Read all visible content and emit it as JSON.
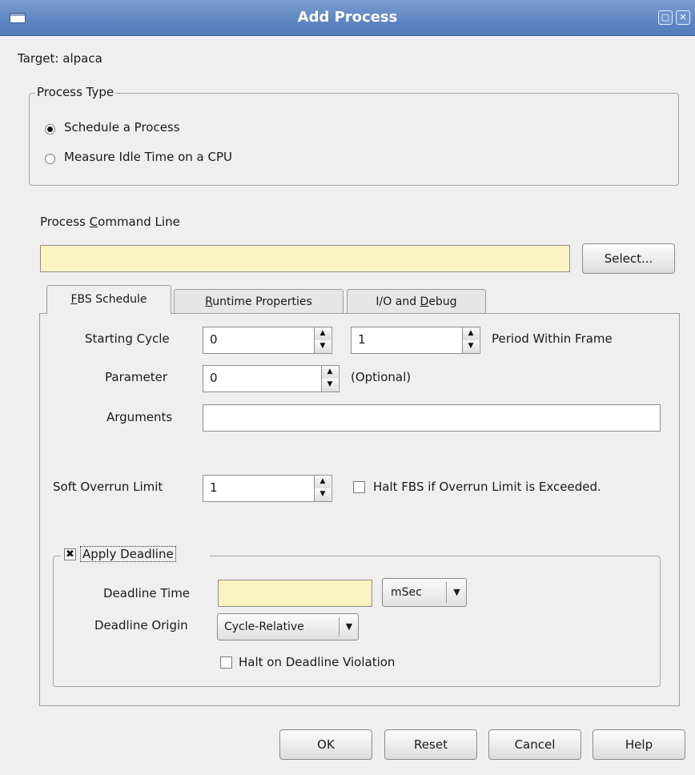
{
  "window": {
    "title": "Add Process",
    "icons": [
      "window-menu-icon",
      "maximize-icon",
      "close-icon"
    ]
  },
  "target": {
    "label": "Target:",
    "value": "alpaca"
  },
  "process_type": {
    "legend": "Process Type",
    "options": [
      {
        "label": "Schedule a Process",
        "selected": true
      },
      {
        "label": "Measure Idle Time on a CPU",
        "selected": false
      }
    ]
  },
  "command_line": {
    "label_pre": "Process ",
    "label_mnemonic": "C",
    "label_post": "ommand Line",
    "value": "",
    "select_label": "Select..."
  },
  "tabs": [
    {
      "mnemonic": "F",
      "rest": "BS Schedule",
      "active": true
    },
    {
      "mnemonic": "R",
      "rest": "untime Properties",
      "active": false
    },
    {
      "pre": "I/O and ",
      "mnemonic": "D",
      "rest": "ebug",
      "active": false
    }
  ],
  "fbs": {
    "starting_cycle_label": "Starting Cycle",
    "starting_cycle_value": "0",
    "period_value": "1",
    "period_label": "Period Within Frame",
    "parameter_label": "Parameter",
    "parameter_value": "0",
    "optional_label": "(Optional)",
    "arguments_label": "Arguments",
    "arguments_value": "",
    "soft_overrun_label": "Soft Overrun Limit",
    "soft_overrun_value": "1",
    "halt_fbs_label": "Halt FBS if Overrun Limit is Exceeded.",
    "halt_fbs_checked": false
  },
  "deadline": {
    "apply_label": "Apply Deadline",
    "apply_checked": true,
    "time_label": "Deadline Time",
    "time_value": "",
    "unit_value": "mSec",
    "origin_label": "Deadline Origin",
    "origin_value": "Cycle-Relative",
    "halt_label": "Halt on Deadline Violation",
    "halt_checked": false
  },
  "buttons": {
    "ok": "OK",
    "reset": "Reset",
    "cancel": "Cancel",
    "help": "Help"
  },
  "colors": {
    "titlebar": "#5f86c2",
    "required_field": "#fbf4c2"
  }
}
